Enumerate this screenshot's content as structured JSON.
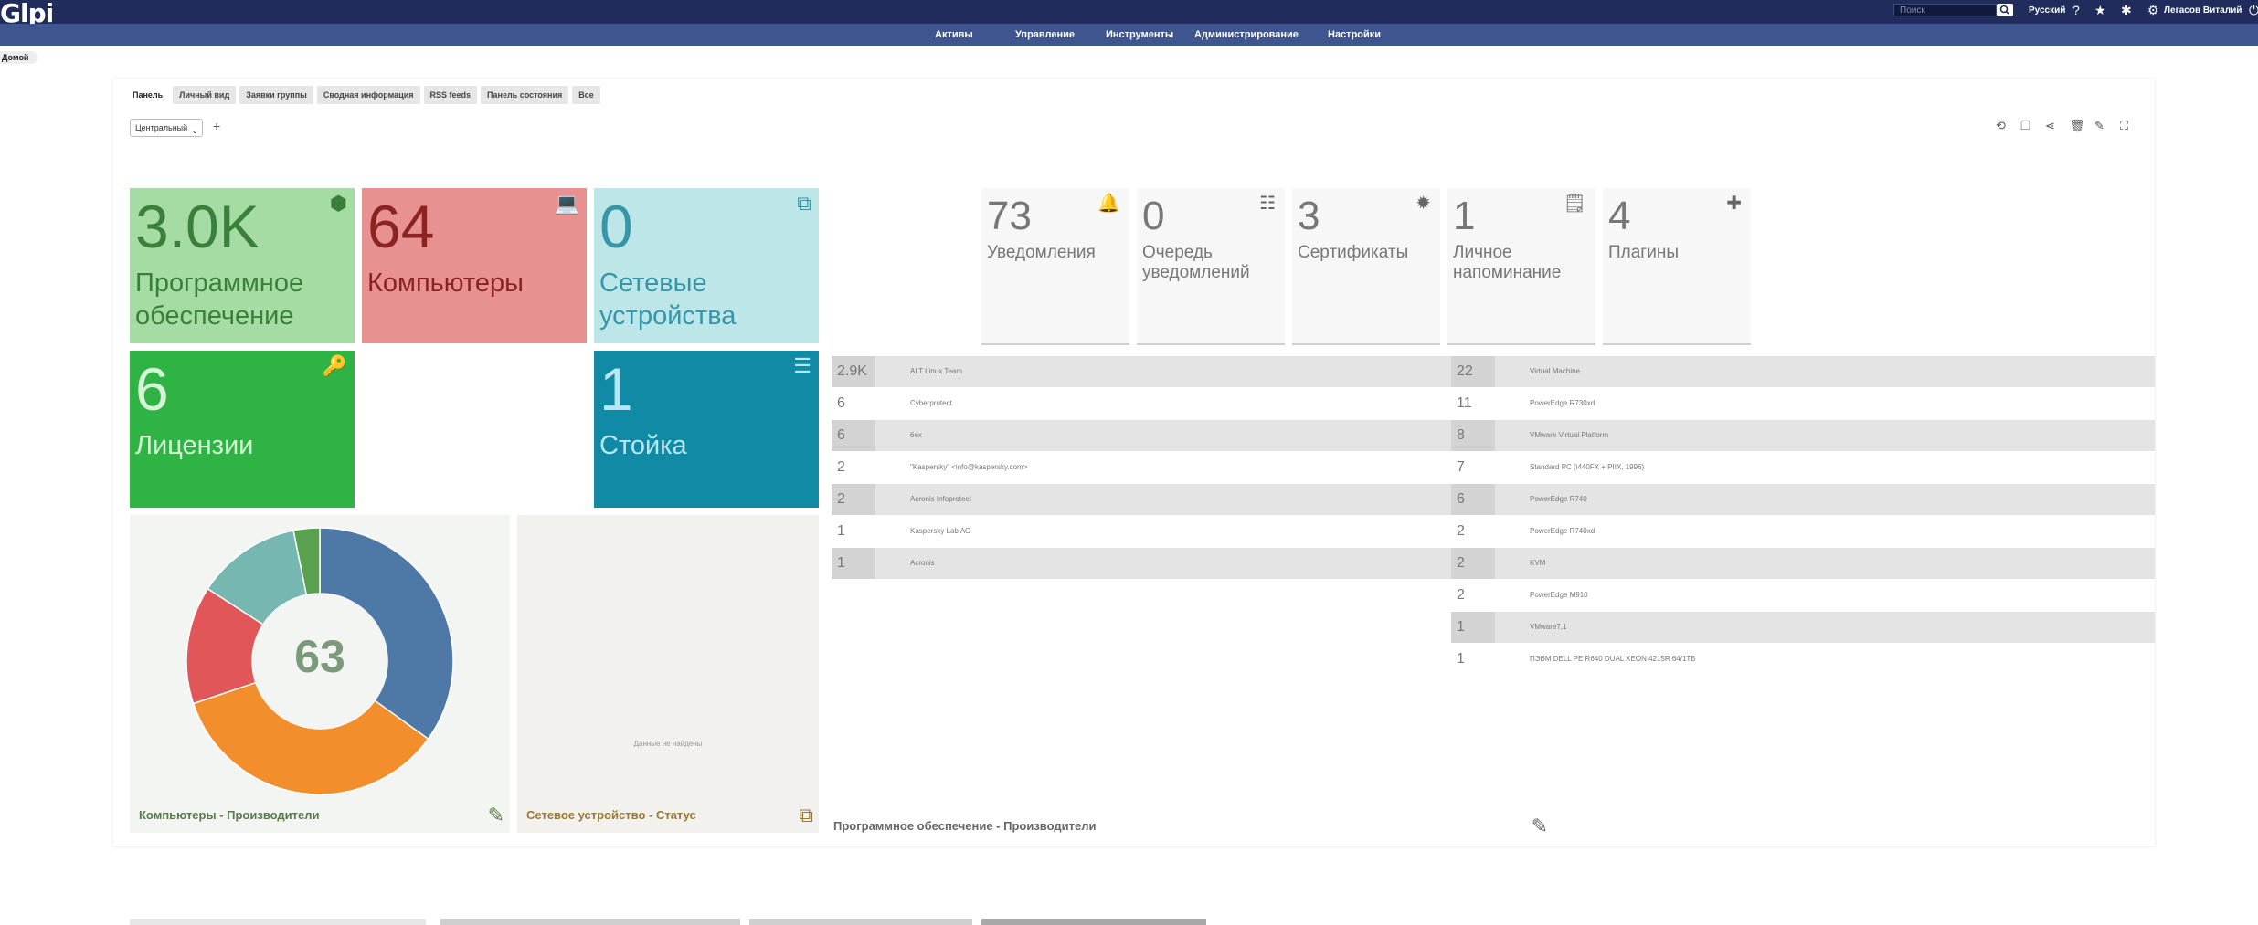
{
  "header": {
    "logo": "Glpi",
    "search_placeholder": "Поиск",
    "language": "Русский",
    "user": "Легасов Виталий",
    "icons": [
      "search-icon",
      "help-icon",
      "star-icon",
      "bug-icon",
      "gear-icon",
      "logout-icon"
    ]
  },
  "menu": [
    "Активы",
    "Управление",
    "Инструменты",
    "Администрирование",
    "Настройки"
  ],
  "breadcrumb": "Домой",
  "tabs": [
    "Панель",
    "Личный вид",
    "Заявки группы",
    "Сводная информация",
    "RSS feeds",
    "Панель состояния",
    "Все"
  ],
  "dashboard": {
    "selected": "Центральный",
    "add": "+",
    "toolbar_icons": [
      "history-icon",
      "clone-icon",
      "share-icon",
      "trash-icon",
      "edit-icon",
      "fullscreen-icon"
    ]
  },
  "cards": [
    {
      "value": "3.0K",
      "label": "Программное обеспечение",
      "icon": "box-icon",
      "bg": "#a4dca4",
      "fg": "#3a7f3a"
    },
    {
      "value": "64",
      "label": "Компьютеры",
      "icon": "laptop-icon",
      "bg": "#e79191",
      "fg": "#8b2323"
    },
    {
      "value": "0",
      "label": "Сетевые устройства",
      "icon": "network-icon",
      "bg": "#bde6e9",
      "fg": "#3696a8"
    },
    {
      "value": "6",
      "label": "Лицензии",
      "icon": "key-icon",
      "bg": "#2eb344",
      "fg": "#d6f5d6"
    },
    {
      "value": "1",
      "label": "Стойка",
      "icon": "server-icon",
      "bg": "#118aa5",
      "fg": "#b6e7f2"
    }
  ],
  "gray_cards": [
    {
      "value": "73",
      "label": "Уведомления",
      "icon": "bell-icon"
    },
    {
      "value": "0",
      "label": "Очередь уведомлений",
      "icon": "list-icon"
    },
    {
      "value": "3",
      "label": "Сертификаты",
      "icon": "certificate-icon"
    },
    {
      "value": "1",
      "label": "Личное напоминание",
      "icon": "note-icon"
    },
    {
      "value": "4",
      "label": "Плагины",
      "icon": "puzzle-icon"
    }
  ],
  "software_manufacturers": [
    {
      "count": "2.9K",
      "name": "ALT Linux Team"
    },
    {
      "count": "6",
      "name": "Cyberprotect"
    },
    {
      "count": "6",
      "name": "6ex"
    },
    {
      "count": "2",
      "name": "\"Kaspersky\" <info@kaspersky.com>"
    },
    {
      "count": "2",
      "name": "Acronis Infoprotect"
    },
    {
      "count": "1",
      "name": "Kaspersky Lab AO"
    },
    {
      "count": "1",
      "name": "Acronis"
    }
  ],
  "computer_models": [
    {
      "count": "22",
      "name": "Virtual Machine"
    },
    {
      "count": "11",
      "name": "PowerEdge R730xd"
    },
    {
      "count": "8",
      "name": "VMware Virtual Platform"
    },
    {
      "count": "7",
      "name": "Standard PC (i440FX + PIIX, 1996)"
    },
    {
      "count": "6",
      "name": "PowerEdge R740"
    },
    {
      "count": "2",
      "name": "PowerEdge R740xd"
    },
    {
      "count": "2",
      "name": "KVM"
    },
    {
      "count": "2",
      "name": "PowerEdge M910"
    },
    {
      "count": "1",
      "name": "VMware7,1"
    },
    {
      "count": "1",
      "name": "ПЭВМ DELL PE R640 DUAL XEON 4215R 64/1ТБ"
    }
  ],
  "panels": {
    "pie_title": "Компьютеры - Производители",
    "pie_total": "63",
    "network_title": "Сетевое устройство - Статус",
    "network_empty": "Данные не найдены",
    "software_title": "Программное обеспечение - Производители"
  },
  "chart_data": {
    "type": "pie",
    "title": "Компьютеры - Производители",
    "total": 63,
    "slices": [
      {
        "value": 22,
        "color": "#4e79a7"
      },
      {
        "value": 22,
        "color": "#f28e2b"
      },
      {
        "value": 9,
        "color": "#e15759"
      },
      {
        "value": 8,
        "color": "#76b7b2"
      },
      {
        "value": 2,
        "color": "#59a14f"
      }
    ]
  }
}
